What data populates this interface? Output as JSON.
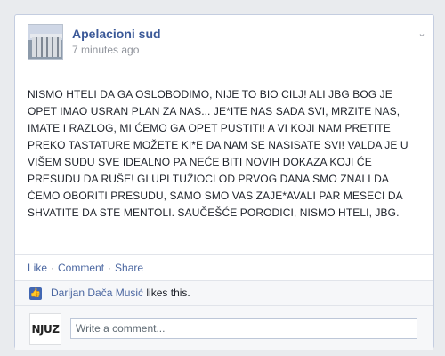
{
  "post": {
    "page_name": "Apelacioni sud",
    "timestamp": "7 minutes ago",
    "body": "NISMO HTELI DA GA OSLOBODIMO, NIJE TO BIO CILJ! ALI JBG BOG JE OPET IMAO USRAN PLAN ZA NAS... JE*ITE NAS SADA SVI, MRZITE NAS, IMATE I RAZLOG, MI ĆEMO GA OPET PUSTITI! A VI KOJI NAM PRETITE PREKO TASTATURE MOŽETE KI*E DA NAM SE NASISATE SVI! VALDA JE U VIŠEM SUDU SVE IDEALNO PA NEĆE BITI NOVIH DOKAZA KOJI ĆE PRESUDU DA RUŠE! GLUPI TUŽIOCI OD PRVOG DANA SMO ZNALI DA ĆEMO OBORITI PRESUDU, SAMO SMO VAS ZAJE*AVALI PAR MESECI DA SHVATITE DA STE MENTOLI. SAUČEŠĆE PORODICI, NISMO HTELI, JBG."
  },
  "actions": {
    "like": "Like",
    "separator": "·",
    "comment": "Comment",
    "share": "Share"
  },
  "likes": {
    "liker": "Darijan Dača Musić",
    "suffix": "likes this."
  },
  "comment_box": {
    "avatar_text": "NJUZ",
    "placeholder": "Write a comment..."
  },
  "colors": {
    "link": "#3b5998",
    "background": "#e9ebee"
  },
  "icons": {
    "thumb": "thumbs-up-icon",
    "menu": "chevron-down-icon"
  }
}
